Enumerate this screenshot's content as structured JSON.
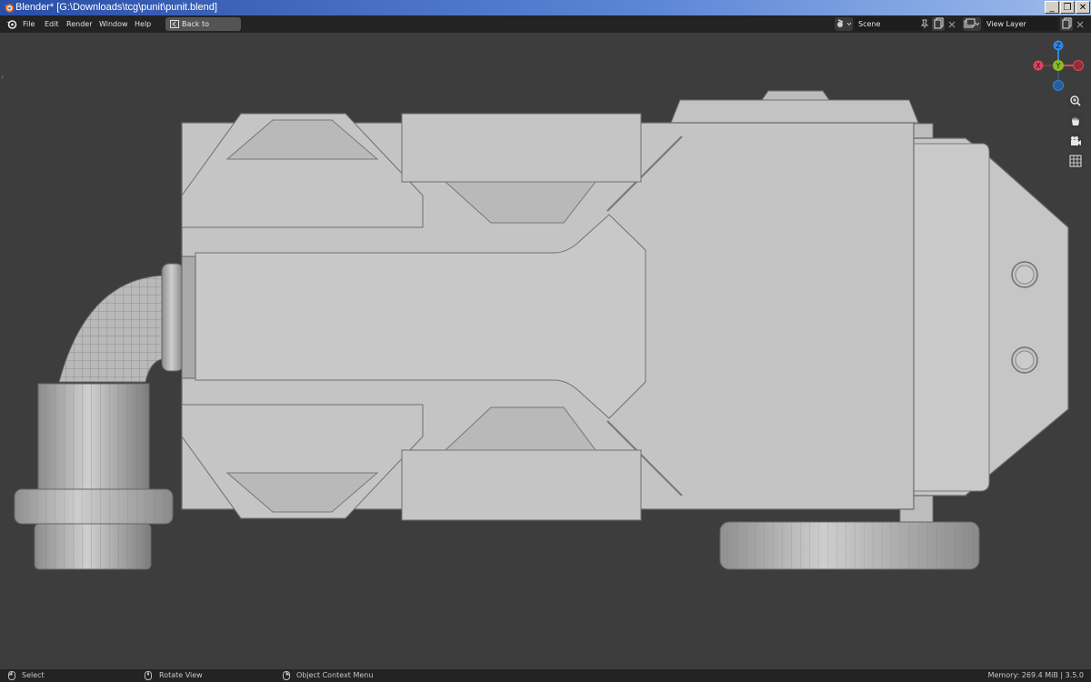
{
  "window": {
    "title": "Blender* [G:\\Downloads\\tcg\\punit\\punit.blend]",
    "controls": [
      "_",
      "❐",
      "✕"
    ]
  },
  "menubar": {
    "items": [
      "File",
      "Edit",
      "Render",
      "Window",
      "Help"
    ],
    "back_button": "Back to Previous",
    "scene_label": "Scene",
    "view_layer_label": "View Layer"
  },
  "gizmo": {
    "axes": [
      "Z",
      "Y",
      "X"
    ],
    "colors": {
      "x": "#e0465a",
      "y": "#8cbc22",
      "z": "#2f86e0"
    }
  },
  "viewport_tools": [
    "zoom-icon",
    "hand-icon",
    "camera-icon",
    "grid-icon"
  ],
  "statusbar": {
    "select": "Select",
    "rotate": "Rotate View",
    "context": "Object Context Menu",
    "memory": "Memory: 269.4 MiB | 3.5.0"
  },
  "colors": {
    "title_gradient_start": "#2a4fa8",
    "menubar_bg": "#232323",
    "viewport_bg": "#3d3d3d",
    "model_fill": "#c7c7c7"
  }
}
